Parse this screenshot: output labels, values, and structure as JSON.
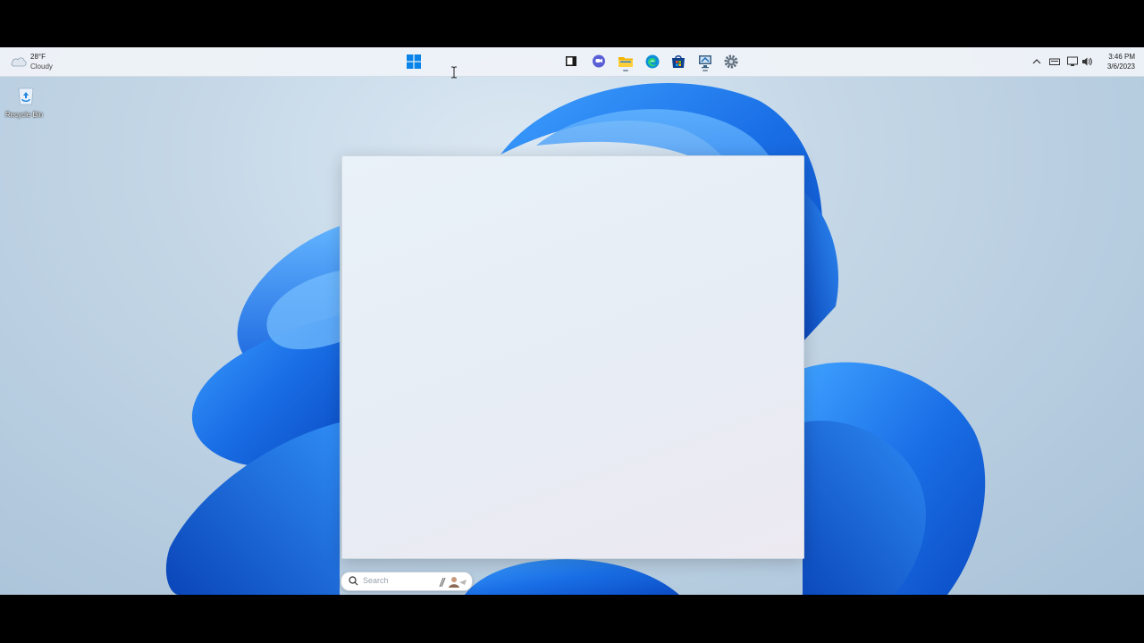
{
  "weather": {
    "temperature": "28°F",
    "condition": "Cloudy"
  },
  "taskbar": {
    "pinned": [
      {
        "name": "start",
        "icon": "windows-logo-icon"
      },
      {
        "name": "task-view",
        "icon": "task-view-icon"
      },
      {
        "name": "chat",
        "icon": "chat-icon"
      },
      {
        "name": "file-explorer",
        "icon": "folder-icon"
      },
      {
        "name": "edge",
        "icon": "edge-icon"
      },
      {
        "name": "store",
        "icon": "store-icon"
      },
      {
        "name": "remote-desktop",
        "icon": "remote-desktop-icon"
      },
      {
        "name": "settings",
        "icon": "gear-icon"
      }
    ]
  },
  "tray": {
    "time": "3:46 PM",
    "date": "3/6/2023"
  },
  "desktop": {
    "recycle_bin_label": "Recycle Bin"
  },
  "search": {
    "placeholder": "Search",
    "value": ""
  },
  "colors": {
    "accent": "#0078d4",
    "wallpaper_blue": "#1a73e8"
  }
}
